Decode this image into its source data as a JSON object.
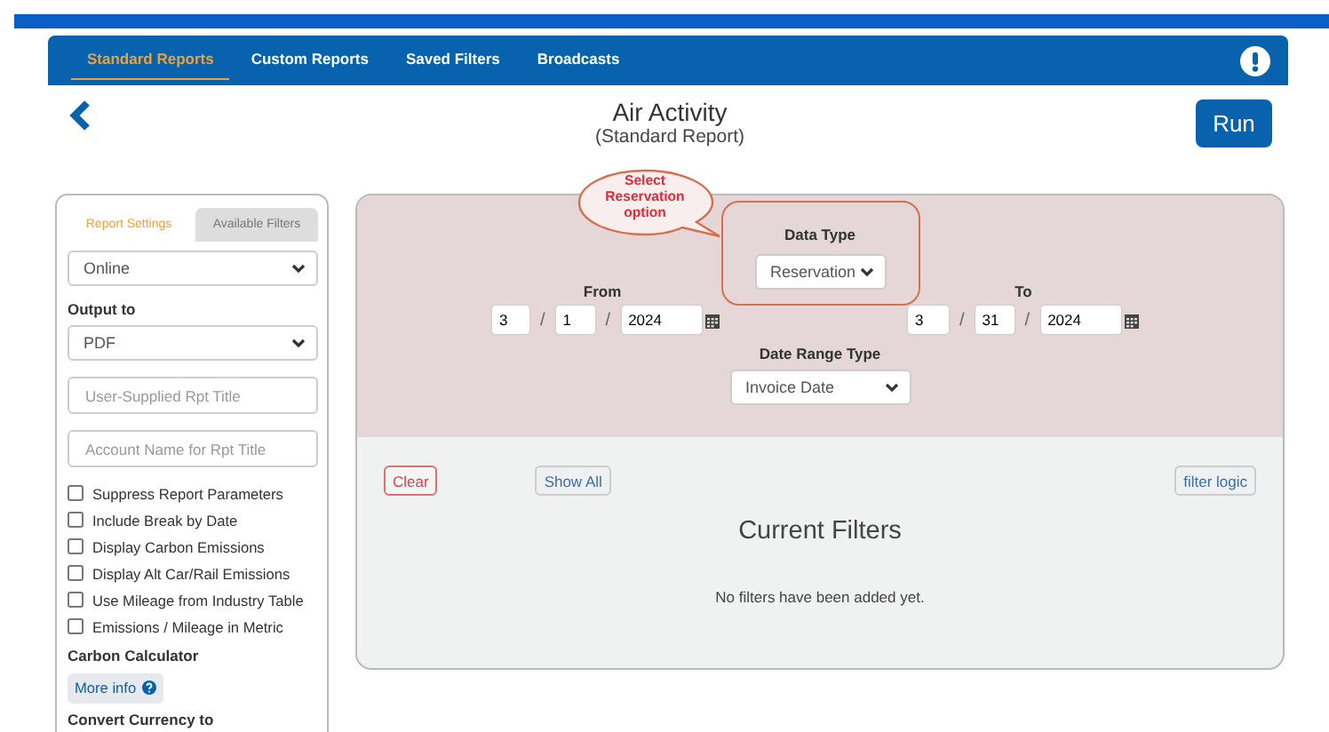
{
  "nav": {
    "tabs": [
      {
        "label": "Standard Reports",
        "selected": true
      },
      {
        "label": "Custom Reports",
        "selected": false
      },
      {
        "label": "Saved Filters",
        "selected": false
      },
      {
        "label": "Broadcasts",
        "selected": false
      }
    ]
  },
  "header": {
    "title": "Air Activity",
    "subtitle": "(Standard Report)",
    "run_button": "Run"
  },
  "settings": {
    "tabs": [
      {
        "label": "Report Settings",
        "selected": true
      },
      {
        "label": "Available Filters",
        "selected": false
      }
    ],
    "mode_select": "Online",
    "output_label": "Output to",
    "output_select": "PDF",
    "fields": [
      {
        "placeholder": "User-Supplied Rpt Title"
      },
      {
        "placeholder": "Account Name for Rpt Title"
      }
    ],
    "options": [
      {
        "label": "Suppress Report Parameters",
        "checked": false
      },
      {
        "label": "Include Break by Date",
        "checked": false
      },
      {
        "label": "Display Carbon Emissions",
        "checked": false
      },
      {
        "label": "Display Alt Car/Rail Emissions",
        "checked": false
      },
      {
        "label": "Use Mileage from Industry Table",
        "checked": false
      },
      {
        "label": "Emissions / Mileage in Metric",
        "checked": false
      }
    ],
    "carbon_label": "Carbon Calculator",
    "more_info": "More info",
    "currency_label": "Convert Currency to"
  },
  "annotation": {
    "text": "Select Reservation option"
  },
  "filters": {
    "data_type_label": "Data Type",
    "data_type": "Reservation",
    "from": {
      "label": "From",
      "parts": [
        "3",
        "1",
        "2024"
      ],
      "separators": [
        "/",
        "/"
      ]
    },
    "to": {
      "label": "To",
      "parts": [
        "3",
        "31",
        "2024"
      ],
      "separators": [
        "/",
        "/"
      ]
    },
    "date_range_label": "Date Range Type",
    "date_range": "Invoice Date"
  },
  "current": {
    "buttons": [
      {
        "label": "Clear",
        "kind": "danger"
      },
      {
        "label": "Show All",
        "kind": "plain"
      },
      {
        "label": "filter logic",
        "kind": "plain"
      }
    ],
    "title": "Current Filters",
    "empty_message": "No filters have been added yet."
  }
}
